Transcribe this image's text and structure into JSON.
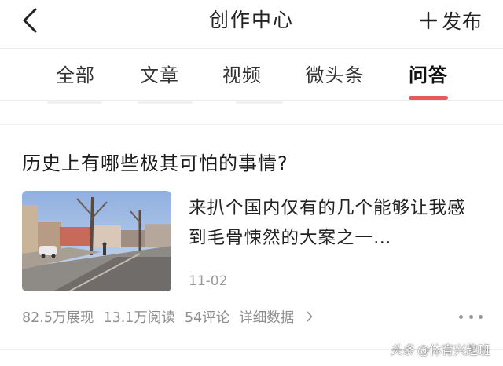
{
  "header": {
    "title": "创作中心",
    "publish_label": "发布",
    "icons": {
      "back": "chevron-left-icon",
      "publish": "plus-icon"
    }
  },
  "tabs": [
    {
      "label": "全部",
      "active": false
    },
    {
      "label": "文章",
      "active": false
    },
    {
      "label": "视频",
      "active": false
    },
    {
      "label": "微头条",
      "active": false
    },
    {
      "label": "问答",
      "active": true
    }
  ],
  "colors": {
    "accent": "#e8575a",
    "text": "#222222",
    "secondary_text": "#8e8e8e",
    "divider": "#ececec"
  },
  "article": {
    "title": "历史上有哪些极其可怕的事情?",
    "excerpt": "来扒个国内仅有的几个能够让我感到毛骨悚然的大案之一…",
    "date": "11-02",
    "stats": {
      "impressions": "82.5万展现",
      "reads": "13.1万阅读",
      "comments": "54评论",
      "detail_label": "详细数据"
    }
  },
  "watermark": {
    "brand": "头条",
    "account": "@体育兴趣班"
  }
}
